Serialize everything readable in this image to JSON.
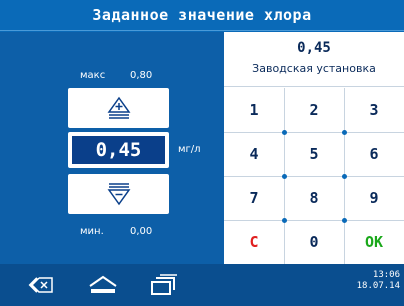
{
  "header": {
    "title": "Заданное значение хлора"
  },
  "limits": {
    "max_label": "макс",
    "max_value": "0,80",
    "min_label": "мин.",
    "min_value": "0,00"
  },
  "current": {
    "value": "0,45",
    "unit": "мг/л"
  },
  "factory": {
    "value": "0,45",
    "label": "Заводская установка"
  },
  "keypad": {
    "keys": [
      "1",
      "2",
      "3",
      "4",
      "5",
      "6",
      "7",
      "8",
      "9",
      "C",
      "0",
      "OK"
    ]
  },
  "statusbar": {
    "time": "13:06",
    "date": "18.07.14"
  },
  "colors": {
    "accent": "#0a6ab8",
    "cancel": "#e02020",
    "ok": "#1aa81a"
  }
}
